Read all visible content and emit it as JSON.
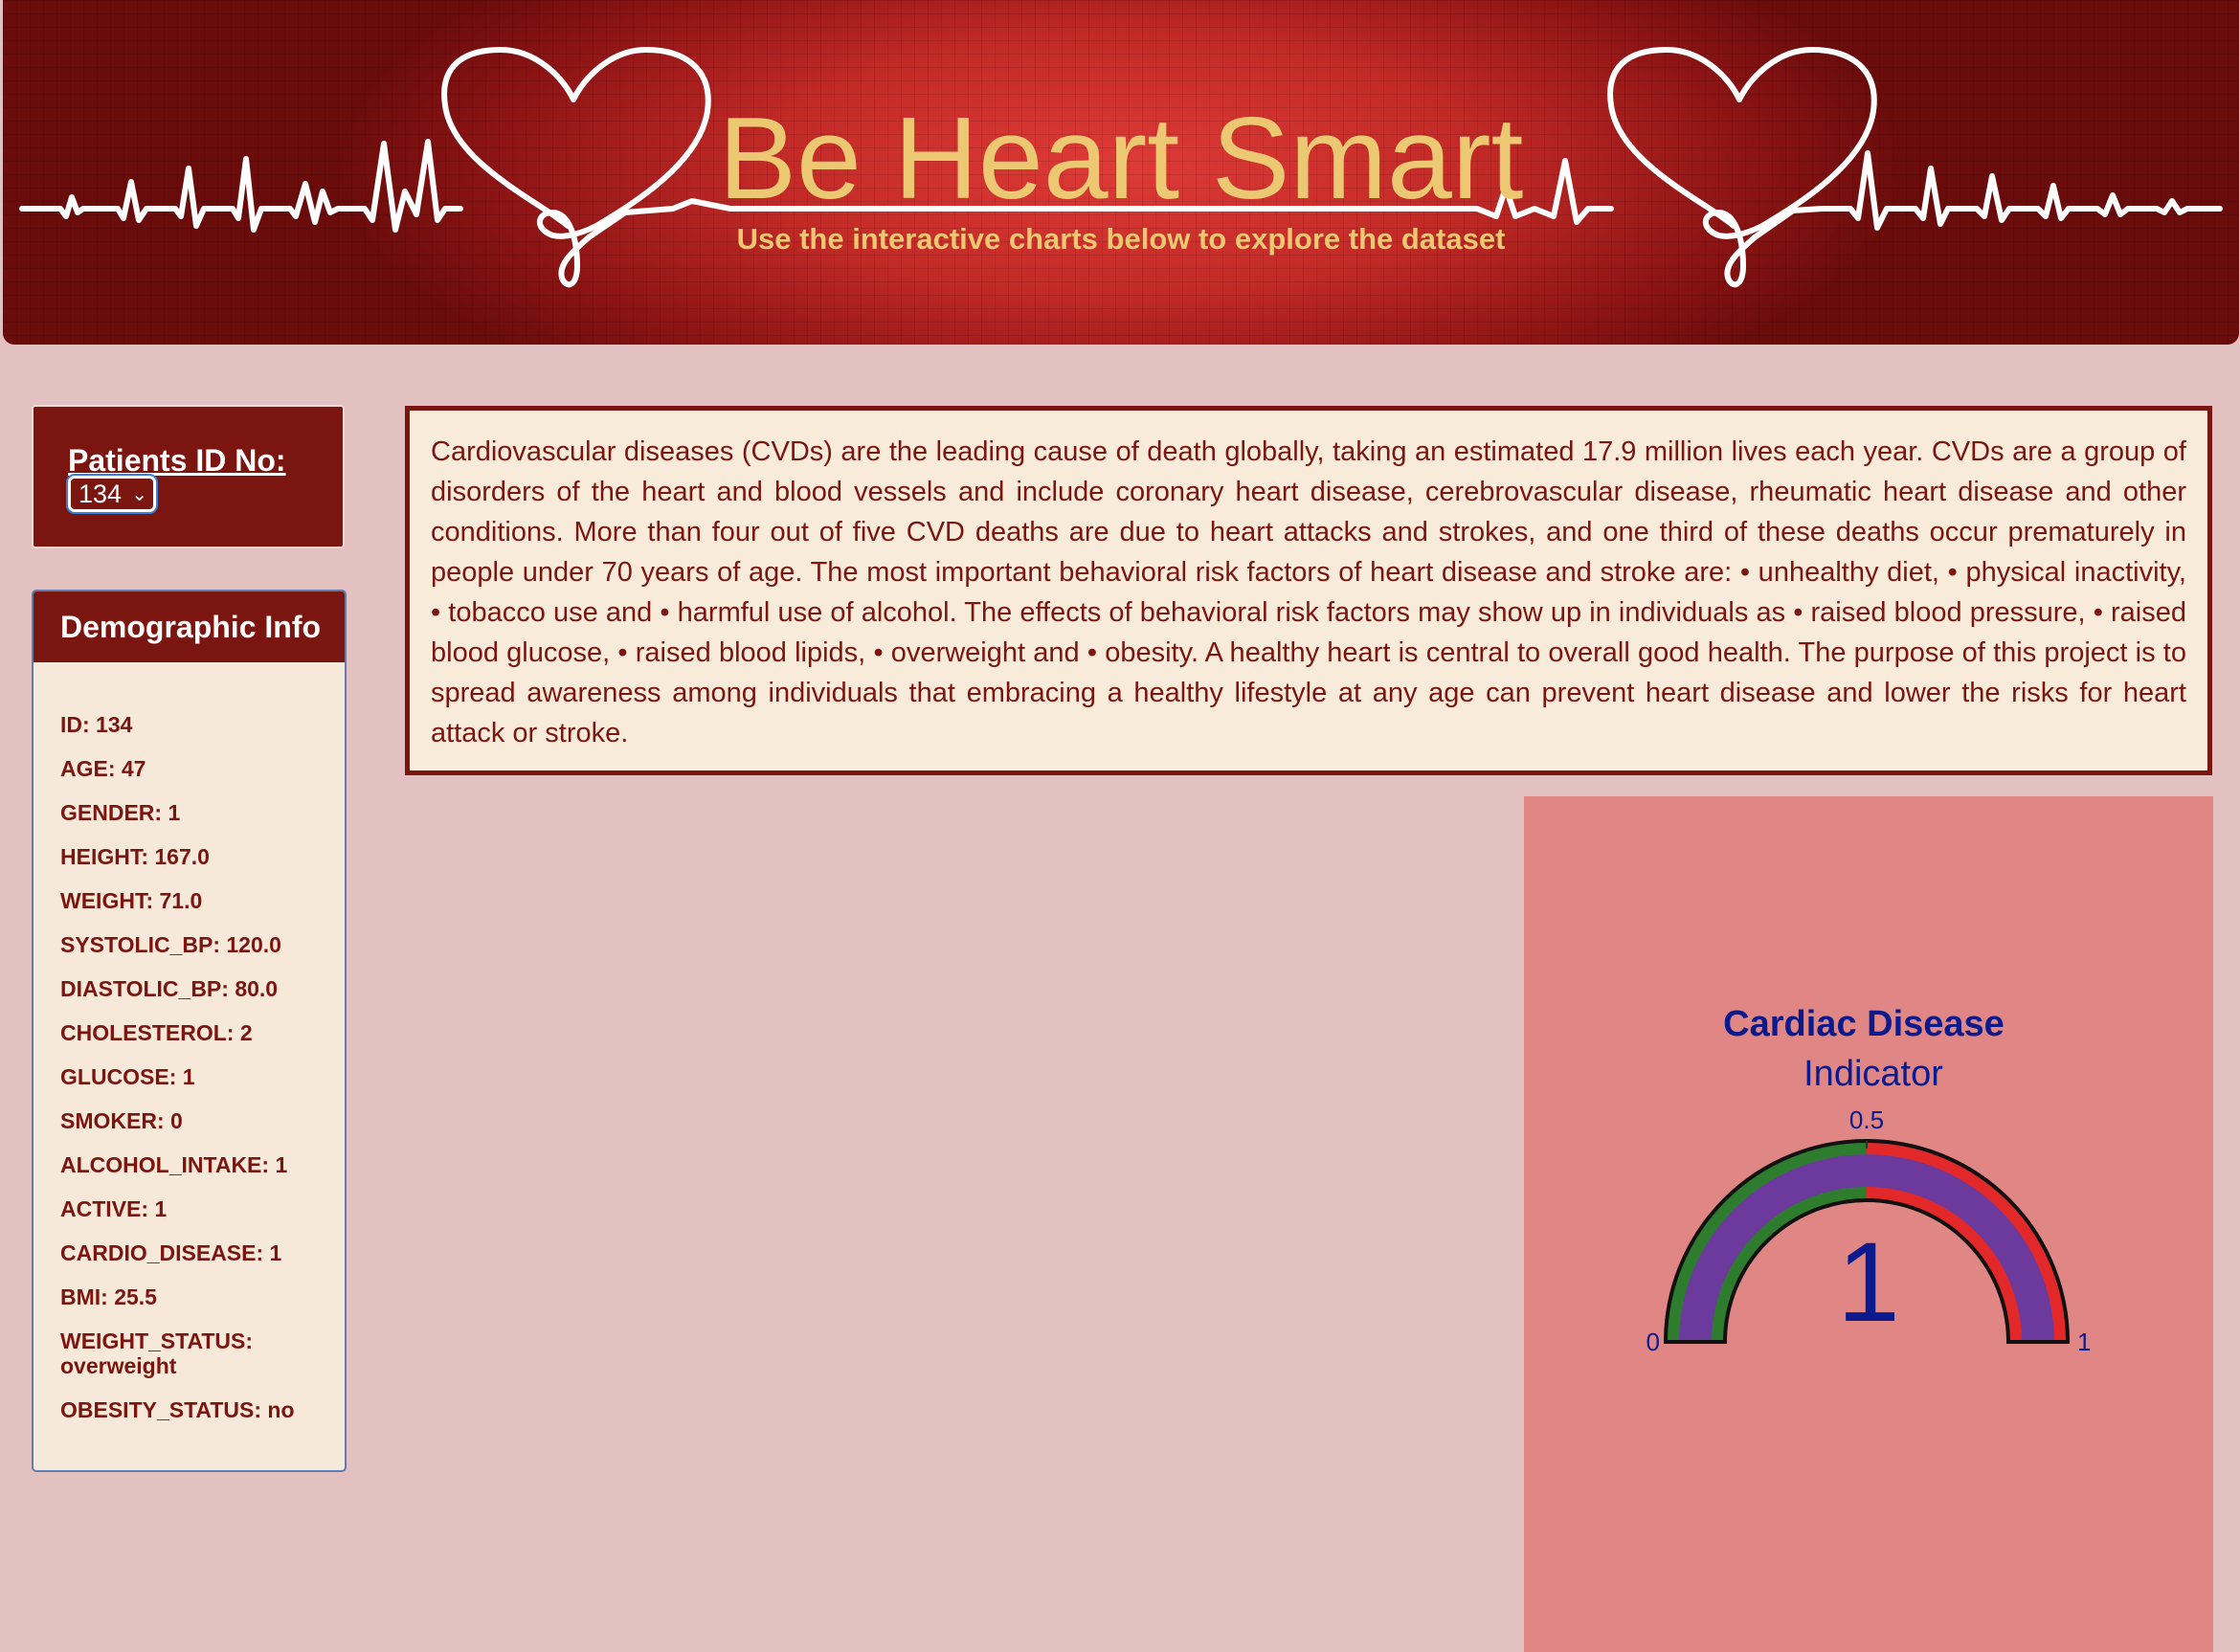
{
  "banner": {
    "title": "Be Heart Smart",
    "subtitle": "Use the interactive charts below to explore the dataset"
  },
  "patient_selector": {
    "label": "Patients ID No:",
    "selected": "134"
  },
  "demographics": {
    "heading": "Demographic Info",
    "items": [
      "ID: 134",
      "AGE: 47",
      "GENDER: 1",
      "HEIGHT: 167.0",
      "WEIGHT: 71.0",
      "SYSTOLIC_BP: 120.0",
      "DIASTOLIC_BP: 80.0",
      "CHOLESTEROL: 2",
      "GLUCOSE: 1",
      "SMOKER: 0",
      "ALCOHOL_INTAKE: 1",
      "ACTIVE: 1",
      "CARDIO_DISEASE: 1",
      "BMI: 25.5",
      "WEIGHT_STATUS: overweight",
      "OBESITY_STATUS: no"
    ]
  },
  "intro_text": "Cardiovascular diseases (CVDs) are the leading cause of death globally, taking an estimated 17.9 million lives each year. CVDs are a group of disorders of the heart and blood vessels and include coronary heart disease, cerebrovascular disease, rheumatic heart disease and other conditions. More than four out of five CVD deaths are due to heart attacks and strokes, and one third of these deaths occur prematurely in people under 70 years of age. The most important behavioral risk factors of heart disease and stroke are: • unhealthy diet, • physical inactivity, • tobacco use and • harmful use of alcohol. The effects of behavioral risk factors may show up in individuals as • raised blood pressure, • raised blood glucose, • raised blood lipids, • overweight and • obesity. A healthy heart is central to overall good health. The purpose of this project is to spread awareness among individuals that embracing a healthy lifestyle at any age can prevent heart disease and lower the risks for heart attack or stroke.",
  "gauge": {
    "title_line1": "Cardiac Disease",
    "title_line2": "Indicator",
    "value": 1,
    "value_label": "1",
    "range": [
      0,
      1
    ],
    "tick_min": "0",
    "tick_mid": "0.5",
    "tick_max": "1",
    "steps": [
      {
        "range": [
          0,
          0.5
        ],
        "color": "#2e7d2e"
      },
      {
        "range": [
          0.5,
          1
        ],
        "color": "#e3282a"
      }
    ],
    "bar_color": "#6b3a9c",
    "title_color": "#0b1a8c"
  },
  "colors": {
    "accent": "#7b1510",
    "page_bg": "#e4c1c1",
    "banner_text": "#ecc873"
  }
}
